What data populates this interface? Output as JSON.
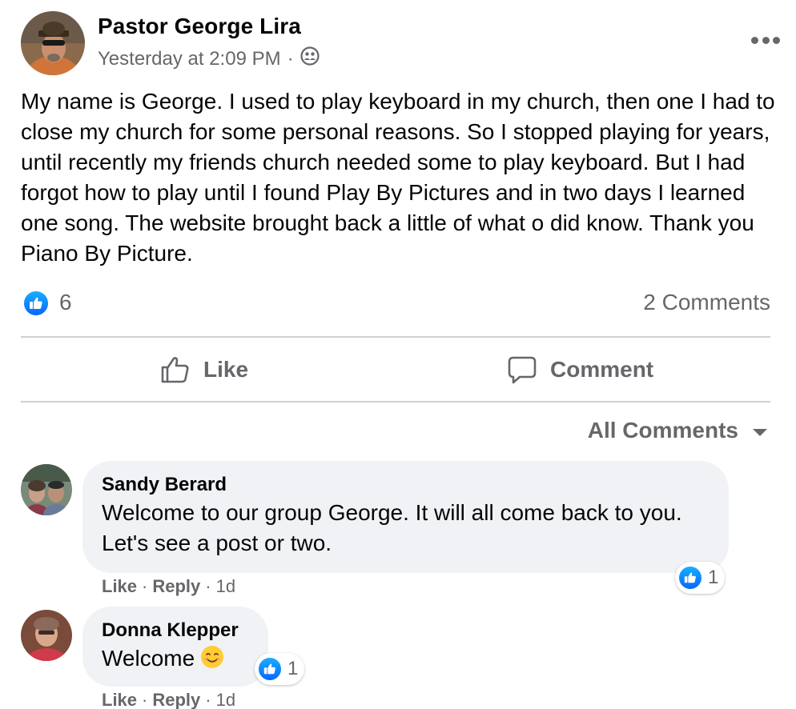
{
  "post": {
    "author": "Pastor George Lira",
    "timestamp": "Yesterday at 2:09 PM",
    "separator": "·",
    "audience_icon": "group-audience-icon",
    "more_icon": "more-options-icon",
    "body": "My name is George. I used to play keyboard in my church, then one I had to close my church for some personal reasons. So I stopped playing for years, until recently my friends church needed some to play keyboard. But I had forgot how to play until I found Play By Pictures and in two days I learned one song. The website brought back a little of what o did know. Thank you Piano By Picture.",
    "reaction_count": "6",
    "comments_count": "2 Comments"
  },
  "actions": {
    "like_label": "Like",
    "comment_label": "Comment"
  },
  "comments_filter": {
    "label": "All Comments"
  },
  "comments": [
    {
      "author": "Sandy Berard",
      "text": "Welcome to our group George. It will all come back to you. Let's see a post or two.",
      "like_label": "Like",
      "reply_label": "Reply",
      "time": "1d",
      "reaction_count": "1"
    },
    {
      "author": "Donna Klepper",
      "text": "Welcome",
      "emoji": "😊",
      "like_label": "Like",
      "reply_label": "Reply",
      "time": "1d",
      "reaction_count": "1"
    }
  ],
  "colors": {
    "accent": "#0866ff",
    "secondary_text": "#65676b",
    "bubble": "#f0f2f5",
    "divider": "#ced0d4"
  }
}
